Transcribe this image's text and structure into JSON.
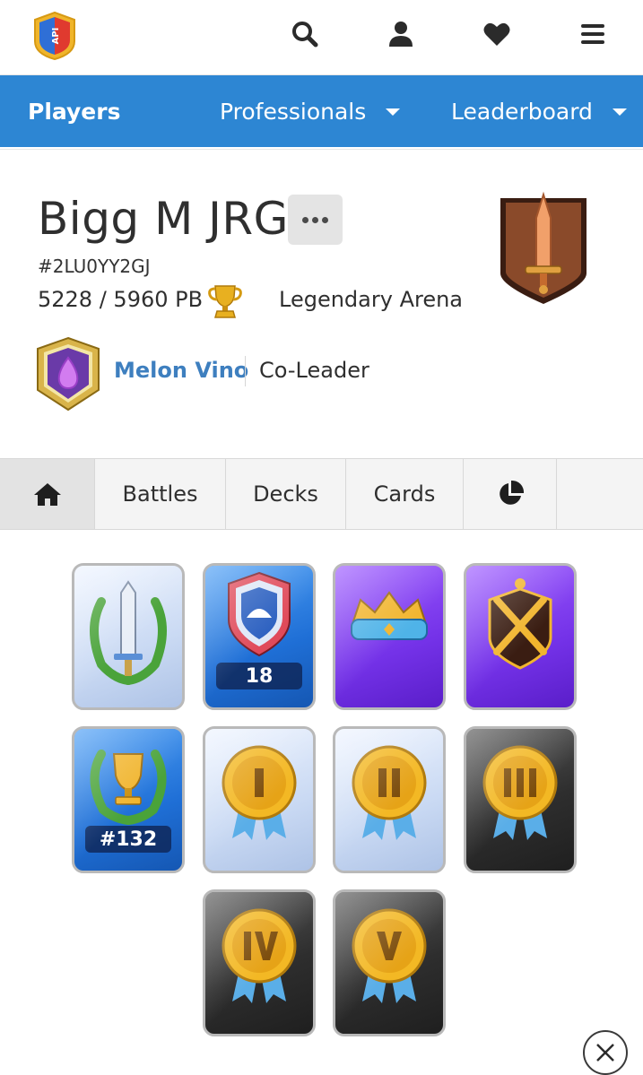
{
  "header": {
    "logo_icon": "royaleapi-logo",
    "icons": [
      "search-icon",
      "user-icon",
      "heart-icon",
      "menu-icon"
    ]
  },
  "nav": {
    "players": "Players",
    "professionals": "Professionals",
    "leaderboard": "Leaderboard"
  },
  "profile": {
    "name": "Bigg M JRG",
    "tag": "#2LU0YY2GJ",
    "trophies": "5228 / 5960 PB",
    "arena": "Legendary Arena",
    "clan_name": "Melon Vino",
    "clan_role": "Co-Leader"
  },
  "tabs": {
    "battles": "Battles",
    "decks": "Decks",
    "cards": "Cards"
  },
  "badges": [
    {
      "icon": "sword-laurel-icon",
      "label": ""
    },
    {
      "icon": "clan-shield-icon",
      "label": "18"
    },
    {
      "icon": "crown-icon",
      "label": ""
    },
    {
      "icon": "crossed-swords-icon",
      "label": ""
    },
    {
      "icon": "trophy-laurel-icon",
      "label": "#132"
    },
    {
      "icon": "medal-i-icon",
      "label": ""
    },
    {
      "icon": "medal-ii-icon",
      "label": ""
    },
    {
      "icon": "medal-iii-icon",
      "label": ""
    },
    {
      "icon": "medal-iv-icon",
      "label": ""
    },
    {
      "icon": "medal-v-icon",
      "label": ""
    }
  ],
  "colors": {
    "nav_blue": "#2d86d3",
    "clan_link": "#3e7fbf"
  }
}
